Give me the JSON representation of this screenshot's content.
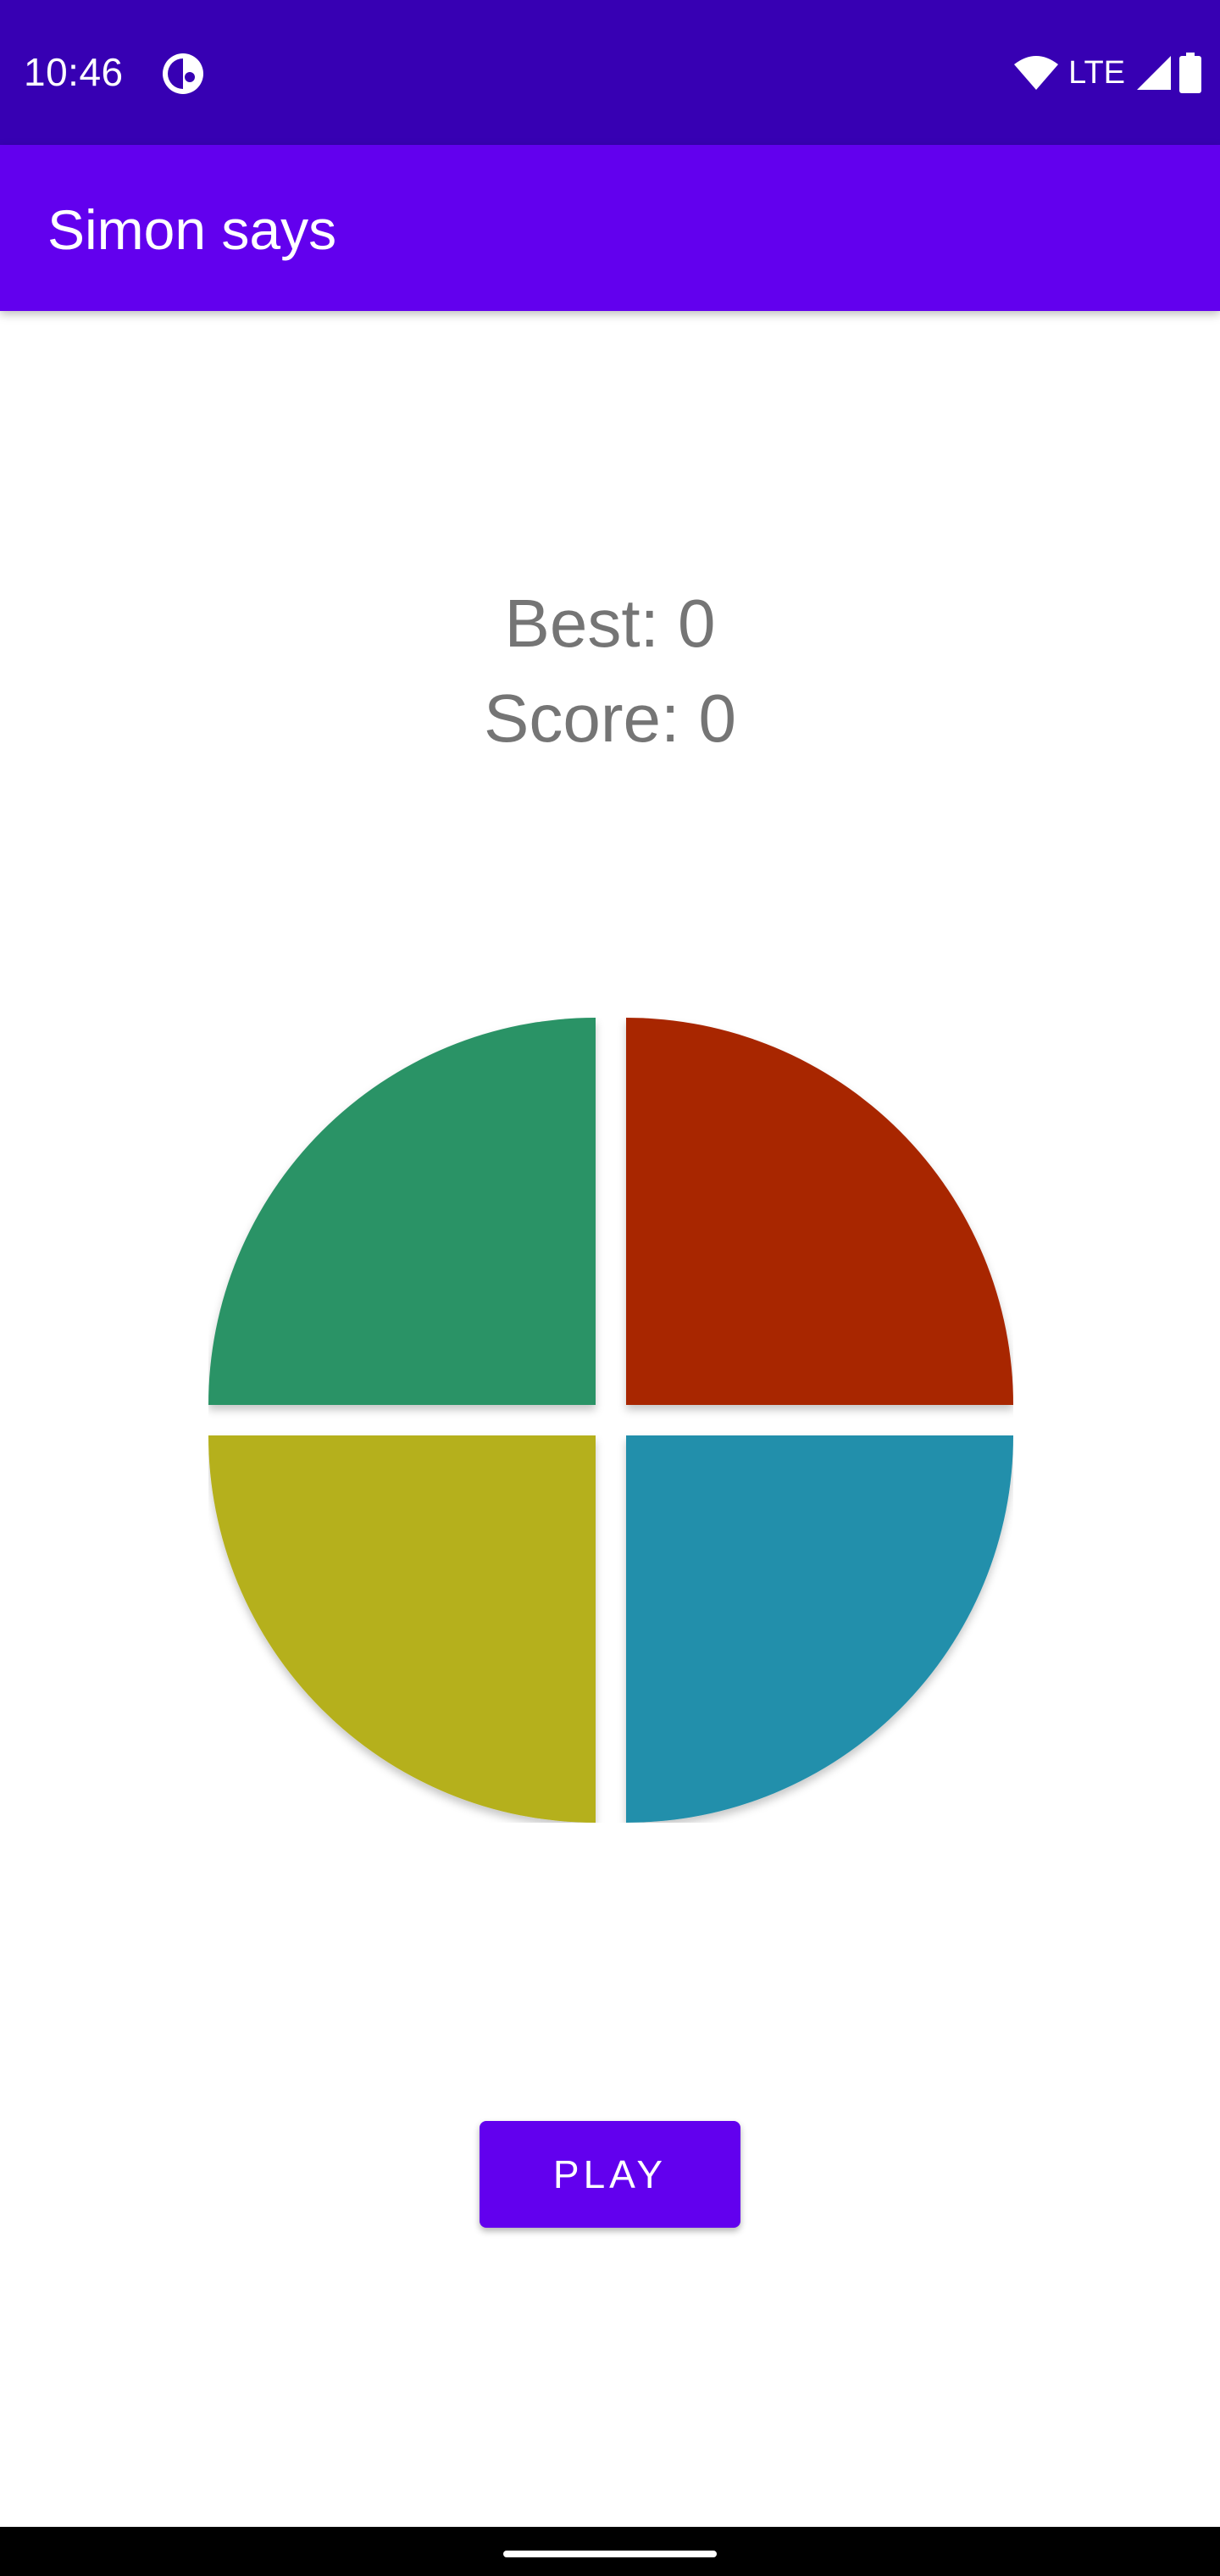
{
  "status_bar": {
    "time": "10:46",
    "network": "LTE",
    "icons": [
      "app-notification-icon",
      "wifi-icon",
      "cellular-signal-icon",
      "battery-icon"
    ]
  },
  "app_bar": {
    "title": "Simon says"
  },
  "scores": {
    "best": "Best: 0",
    "score": "Score: 0"
  },
  "board": {
    "quadrants": [
      {
        "name": "green",
        "color": "#2b9366"
      },
      {
        "name": "red",
        "color": "#a82702"
      },
      {
        "name": "yellow",
        "color": "#b5b01a"
      },
      {
        "name": "blue",
        "color": "#208fab"
      }
    ]
  },
  "play_button": {
    "label": "PLAY"
  },
  "colors": {
    "status_bar": "#3700b3",
    "app_bar": "#6200ee",
    "accent": "#6200ee"
  }
}
